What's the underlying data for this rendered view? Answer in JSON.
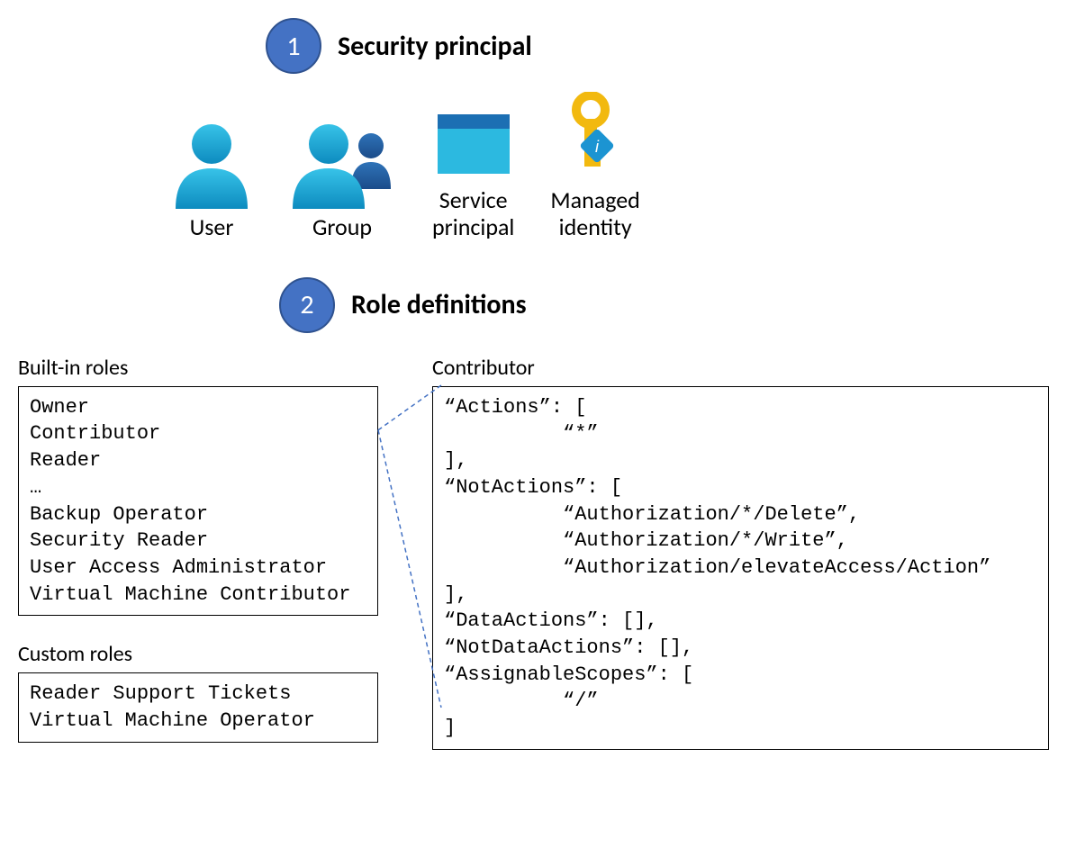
{
  "section1": {
    "number": "1",
    "title": "Security principal",
    "principals": [
      {
        "label": "User"
      },
      {
        "label": "Group"
      },
      {
        "label": "Service\nprincipal"
      },
      {
        "label": "Managed\nidentity"
      }
    ]
  },
  "section2": {
    "number": "2",
    "title": "Role definitions",
    "builtin_title": "Built-in roles",
    "builtin_roles": "Owner\nContributor\nReader\n…\nBackup Operator\nSecurity Reader\nUser Access Administrator\nVirtual Machine Contributor",
    "custom_title": "Custom roles",
    "custom_roles": "Reader Support Tickets\nVirtual Machine Operator",
    "contributor_title": "Contributor",
    "contributor_body": "“Actions”: [\n          “*”\n],\n“NotActions”: [\n          “Authorization/*/Delete”,\n          “Authorization/*/Write”,\n          “Authorization/elevateAccess/Action”\n],\n“DataActions”: [],\n“NotDataActions”: [],\n“AssignableScopes”: [\n          “/”\n]"
  }
}
